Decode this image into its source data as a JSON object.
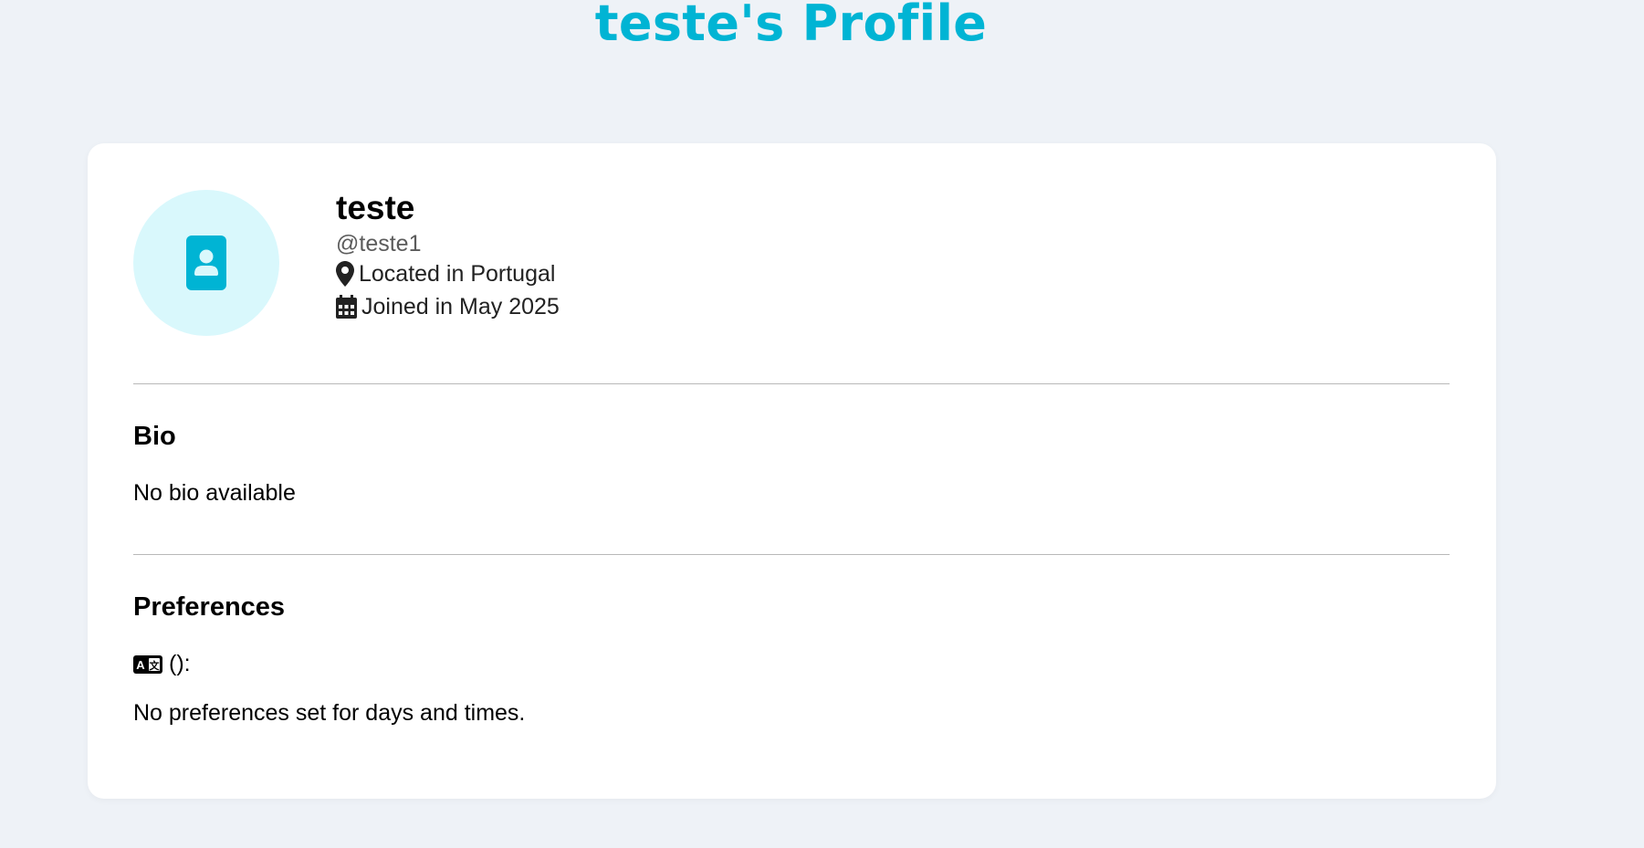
{
  "page": {
    "title": "teste's Profile",
    "accent_color": "#00b4d4",
    "background_color": "#eef2f7"
  },
  "profile": {
    "avatar_icon": "contact-card-icon",
    "display_name": "teste",
    "username": "@teste1",
    "location_icon": "map-pin-icon",
    "location_text": "Located in Portugal",
    "joined_icon": "calendar-icon",
    "joined_text": "Joined in May 2025"
  },
  "bio": {
    "heading": "Bio",
    "text": "No bio available"
  },
  "preferences": {
    "heading": "Preferences",
    "language_icon": "language-translate-icon",
    "language_text": "():",
    "schedule_text": "No preferences set for days and times."
  }
}
